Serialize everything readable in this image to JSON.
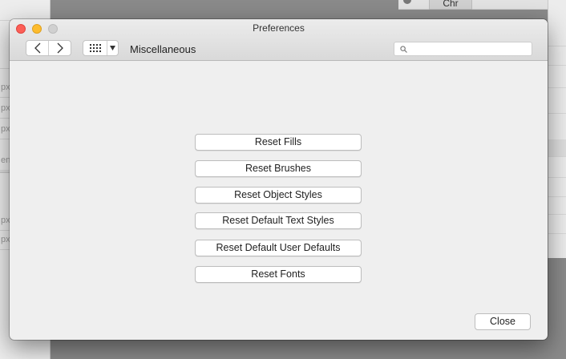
{
  "background": {
    "left_panel_labels": [
      "px",
      "px",
      "px",
      "en",
      "px",
      "px"
    ],
    "right_panel_tab": "Chr"
  },
  "window": {
    "title": "Preferences",
    "section_title": "Miscellaneous",
    "search": {
      "value": "",
      "placeholder": ""
    }
  },
  "buttons": {
    "reset_fills": "Reset Fills",
    "reset_brushes": "Reset Brushes",
    "reset_object_styles": "Reset Object Styles",
    "reset_default_text_styles": "Reset Default Text Styles",
    "reset_default_user_defaults": "Reset Default User Defaults",
    "reset_fonts": "Reset Fonts",
    "close": "Close"
  },
  "colors": {
    "close_light": "#fc5f57",
    "minimize_light": "#fdbc2e",
    "zoom_light": "#d0d0d0"
  }
}
